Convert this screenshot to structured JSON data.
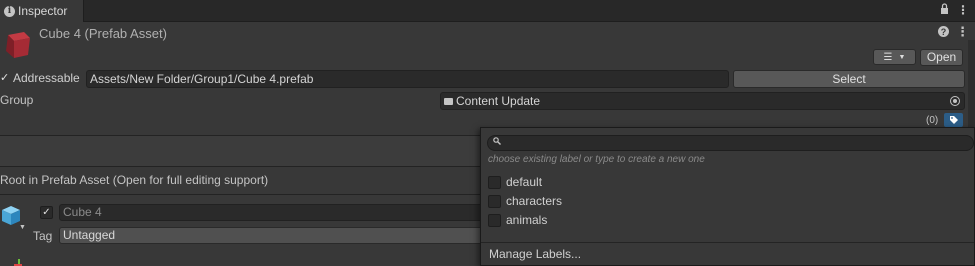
{
  "tab": {
    "title": "Inspector",
    "info_icon": "info-icon"
  },
  "header": {
    "asset_title": "Cube 4 (Prefab Asset)",
    "open_label": "Open"
  },
  "addressable": {
    "checked": true,
    "check_glyph": "✓",
    "label": "Addressable",
    "path": "Assets/New Folder/Group1/Cube 4.prefab",
    "select_label": "Select"
  },
  "group": {
    "label": "Group",
    "value": "Content Update"
  },
  "labels": {
    "count": "(0)"
  },
  "prefab_note": "Root in Prefab Asset (Open for full editing support)",
  "gameobject": {
    "active_check": "✓",
    "name": "Cube 4",
    "tag_label": "Tag",
    "tag_value": "Untagged"
  },
  "popup": {
    "search_placeholder": "",
    "hint": "choose existing label or type to create a new one",
    "items": [
      {
        "label": "default",
        "checked": false
      },
      {
        "label": "characters",
        "checked": false
      },
      {
        "label": "animals",
        "checked": false
      }
    ],
    "manage": "Manage Labels..."
  },
  "colors": {
    "panel": "#383838",
    "field": "#2a2a2a",
    "accent": "#2c5d87",
    "tab_bar": "#282828"
  }
}
